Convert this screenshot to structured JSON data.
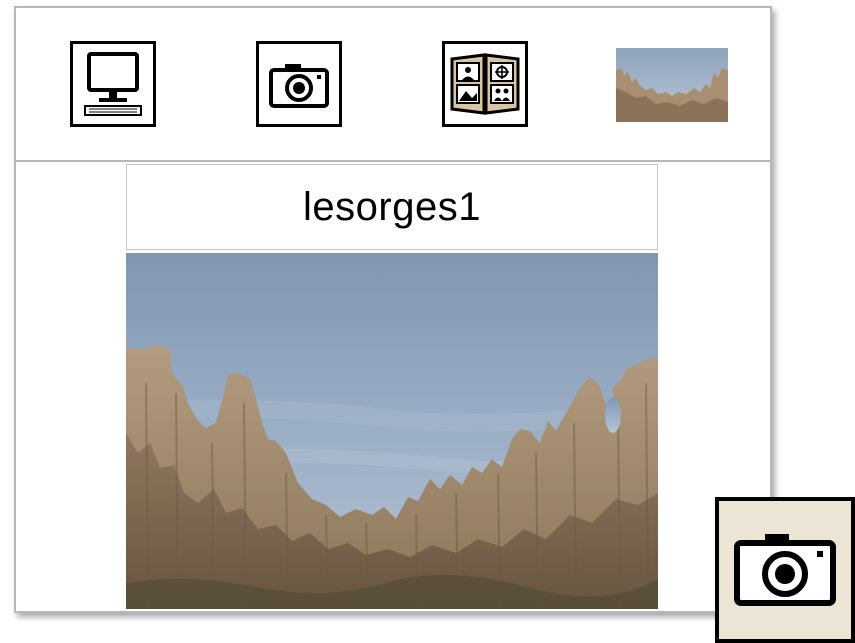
{
  "window": {
    "toolbar": {
      "buttons": [
        {
          "icon": "computer-icon"
        },
        {
          "icon": "camera-icon"
        },
        {
          "icon": "photo-album-icon"
        }
      ],
      "thumbnail_icon": "landscape-thumbnail"
    },
    "photo_title": "lesorges1",
    "photo_subject": "rock-formation-landscape"
  },
  "floating_button": {
    "icon": "camera-icon"
  }
}
